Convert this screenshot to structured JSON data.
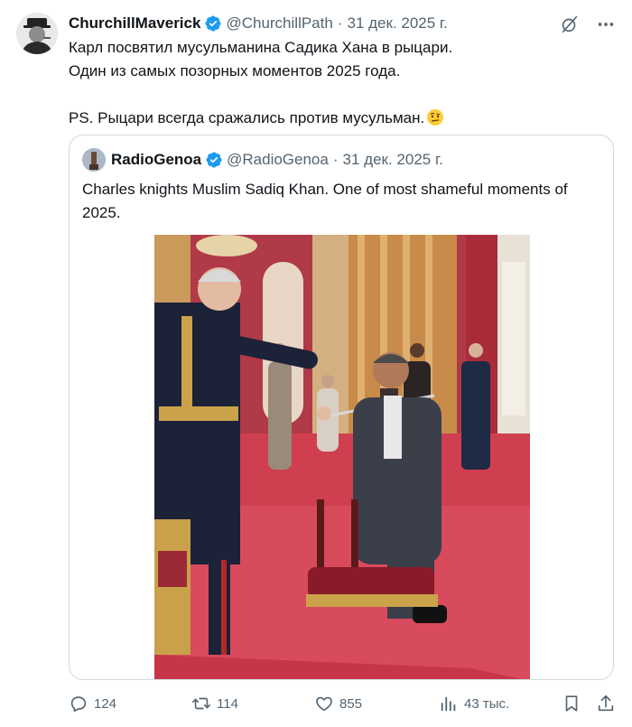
{
  "author": {
    "name": "ChurchillMaverick",
    "handle": "@ChurchillPath",
    "date": "31 дек. 2025 г.",
    "separator": "·"
  },
  "tweet": {
    "line1": "Карл посвятил мусульманина Садика Хана в рыцари.",
    "line2": "Один из самых позорных моментов 2025 года.",
    "line3": "PS. Рыцари всегда сражались против мусульман.",
    "emoji": "face-with-raised-eyebrow"
  },
  "quoted": {
    "name": "RadioGenoa",
    "handle": "@RadioGenoa",
    "date": "31 дек. 2025 г.",
    "separator": "·",
    "text": "Charles knights Muslim Sadiq Khan. One of most shameful moments of 2025."
  },
  "actions": {
    "replies": "124",
    "reposts": "114",
    "likes": "855",
    "views": "43 тыс."
  },
  "icons": {
    "top_right": [
      "grok-slash-icon",
      "more-icon"
    ],
    "bottom_right": [
      "bookmark-icon",
      "share-icon"
    ]
  },
  "colors": {
    "verified": "#1d9bf0",
    "text": "#0f1419",
    "muted": "#536471",
    "border": "#cfd9de"
  }
}
